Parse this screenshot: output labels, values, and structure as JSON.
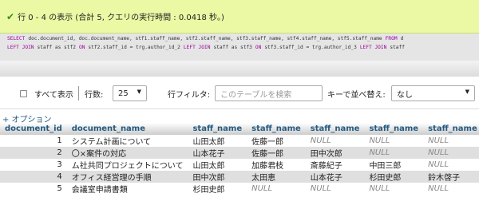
{
  "status": {
    "message": "行 0 - 4 の表示 (合計 5, クエリの実行時間 : 0.0418 秒。)"
  },
  "sql": {
    "line1": [
      {
        "t": "SELECT",
        "k": true
      },
      {
        "t": "doc.document_id, doc.document_name, stf1.staff_name, stf2.staff_name, stf3.staff_name, stf4.staff_name, stf5.staff_name",
        "k": false
      },
      {
        "t": "FROM",
        "k": true
      },
      {
        "t": "d",
        "k": false
      }
    ],
    "line2": [
      {
        "t": "LEFT JOIN",
        "k": true
      },
      {
        "t": "staff as stf2",
        "k": false
      },
      {
        "t": "ON",
        "k": true
      },
      {
        "t": "stf2.staff_id = trg.author_id_2",
        "k": false
      },
      {
        "t": "LEFT JOIN",
        "k": true
      },
      {
        "t": "staff as stf3",
        "k": false
      },
      {
        "t": "ON",
        "k": true
      },
      {
        "t": "stf3.staff_id = trg.author_id_3",
        "k": false
      },
      {
        "t": "LEFT JOIN",
        "k": true
      },
      {
        "t": "staff",
        "k": false
      }
    ]
  },
  "toolbar": {
    "show_all": "すべて表示",
    "rows_label": "行数:",
    "rows_value": "25",
    "filter_label": "行フィルタ:",
    "filter_placeholder": "このテーブルを検索",
    "sort_label": "キーで並べ替え:",
    "sort_value": "なし"
  },
  "options_link": "+ オプション",
  "table": {
    "headers": [
      "document_id",
      "document_name",
      "staff_name",
      "staff_name",
      "staff_name",
      "staff_name",
      "staff_name"
    ],
    "rows": [
      [
        "1",
        "システム計画について",
        "山田太郎",
        "佐藤一郎",
        "NULL",
        "NULL",
        "NULL"
      ],
      [
        "2",
        "〇×案件の対応",
        "山本花子",
        "佐藤一郎",
        "田中次郎",
        "NULL",
        "NULL"
      ],
      [
        "3",
        "ム社共同プロジェクトについて",
        "山田太郎",
        "加藤君枝",
        "斎藤紀子",
        "中田三郎",
        "NULL"
      ],
      [
        "4",
        "オフィス経営理の手順",
        "田中次郎",
        "太田恵",
        "山本花子",
        "杉田史郎",
        "鈴木啓子"
      ],
      [
        "5",
        "会議室申請書類",
        "杉田史郎",
        "NULL",
        "NULL",
        "NULL",
        "NULL"
      ]
    ]
  },
  "colors": {
    "success_bg": "#ebf8a4",
    "link": "#235a81",
    "sql_keyword": "#990099",
    "null_text": "#888888"
  }
}
